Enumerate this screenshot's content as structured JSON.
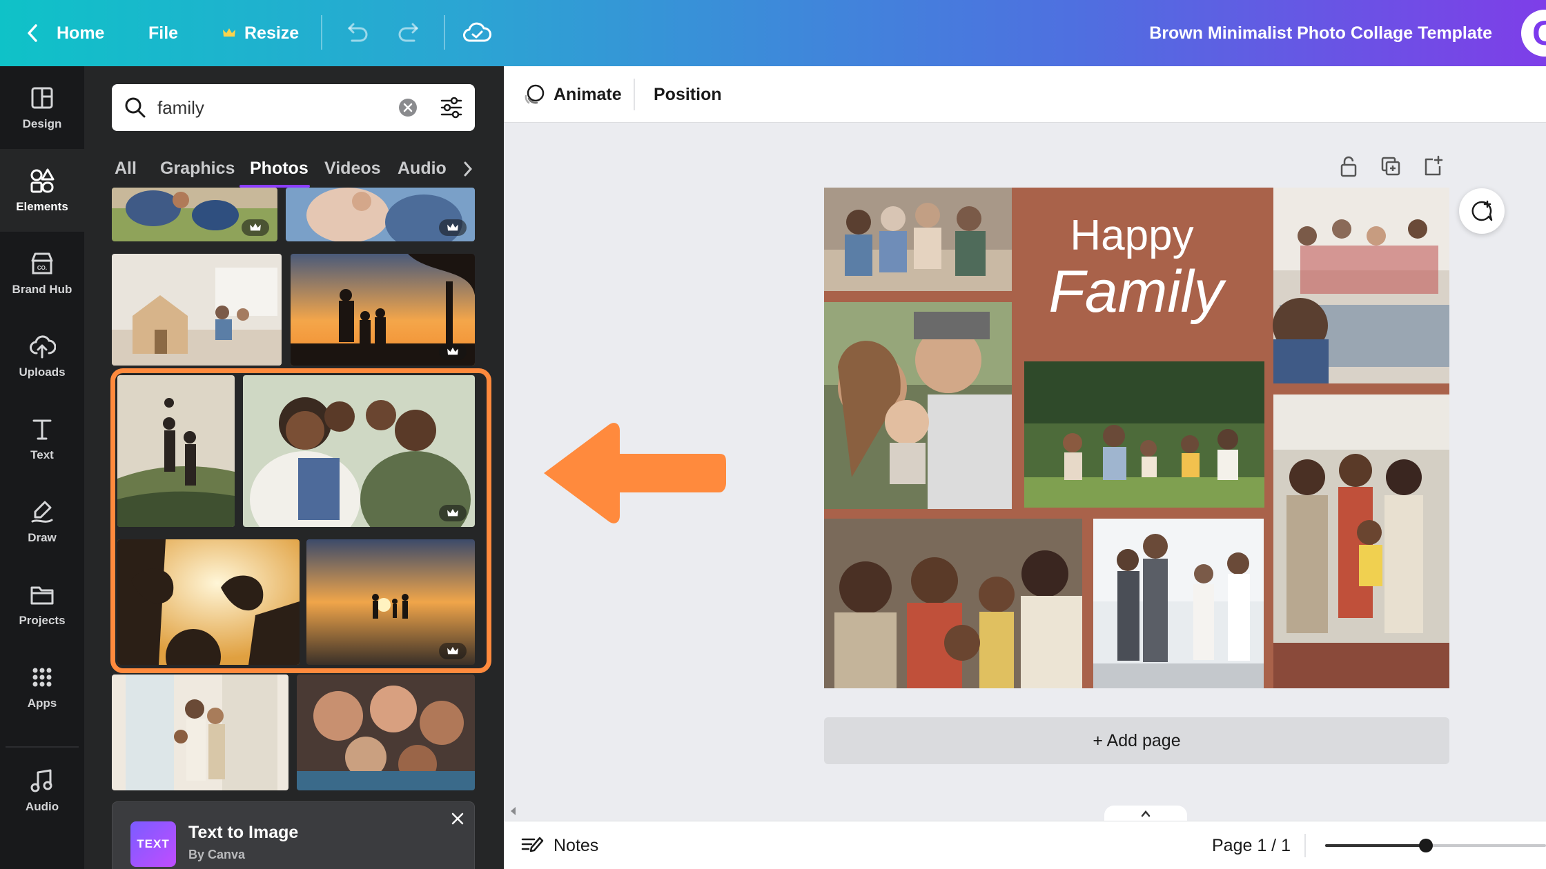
{
  "topbar": {
    "home_label": "Home",
    "file_label": "File",
    "resize_label": "Resize",
    "doc_title": "Brown Minimalist Photo Collage Template",
    "avatar_letter": "C"
  },
  "rail": {
    "items": [
      {
        "label": "Design",
        "icon": "layout-icon"
      },
      {
        "label": "Elements",
        "icon": "shapes-icon"
      },
      {
        "label": "Brand Hub",
        "icon": "brand-icon"
      },
      {
        "label": "Uploads",
        "icon": "cloud-upload-icon"
      },
      {
        "label": "Text",
        "icon": "text-icon"
      },
      {
        "label": "Draw",
        "icon": "draw-icon"
      },
      {
        "label": "Projects",
        "icon": "folder-icon"
      },
      {
        "label": "Apps",
        "icon": "apps-grid-icon"
      },
      {
        "label": "Audio",
        "icon": "music-note-icon"
      }
    ]
  },
  "panel": {
    "search_value": "family",
    "tabs": [
      "All",
      "Graphics",
      "Photos",
      "Videos",
      "Audio"
    ],
    "active_tab": "Photos",
    "text_to_image": {
      "title": "Text to Image",
      "subtitle": "By Canva",
      "icon_text": "TEXT"
    }
  },
  "context_bar": {
    "animate_label": "Animate",
    "position_label": "Position"
  },
  "canvas": {
    "heading_line1": "Happy",
    "heading_line2": "Family",
    "add_page_label": "+ Add page"
  },
  "bottombar": {
    "notes_label": "Notes",
    "page_indicator": "Page 1 / 1"
  },
  "colors": {
    "accent": "#8b3dff",
    "highlight": "#ff8a3d",
    "collage_brown": "#a9624a"
  }
}
